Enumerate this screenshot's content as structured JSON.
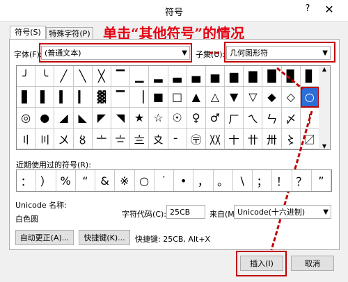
{
  "window": {
    "title": "符号",
    "help_label": "?",
    "close_label": "✕"
  },
  "tabs": [
    {
      "label": "符号(S)"
    },
    {
      "label": "特殊字符(P)"
    }
  ],
  "annotation": "单击“其他符号”的情况",
  "font": {
    "label": "字体(F):",
    "value": "(普通文本)"
  },
  "subset": {
    "label": "子集(U):",
    "value": "几何图形符"
  },
  "symbols": [
    [
      "╯",
      "╰",
      "╱",
      "╲",
      "╳",
      "▔",
      "▁",
      "▂",
      "▃",
      "▄",
      "▅",
      "▆",
      "▇",
      "█",
      "▉",
      "▊"
    ],
    [
      "▋",
      "▌",
      "▍",
      "▎",
      "▓",
      "▔",
      "▕",
      "■",
      "□",
      "▲",
      "△",
      "▼",
      "▽",
      "◆",
      "◇",
      "○"
    ],
    [
      "◎",
      "●",
      "◢",
      "◣",
      "◤",
      "◥",
      "★",
      "☆",
      "☉",
      "♀",
      "♂",
      "ㄏ",
      "ㄟ",
      "ㄣ",
      "〆",
      "〡"
    ],
    [
      "〢",
      "〣",
      "〤",
      "〥",
      "〦",
      "〧",
      "〨",
      "〩",
      "╴",
      "〶",
      "〷",
      "〸",
      "〹",
      "〺",
      "〻",
      "〼"
    ]
  ],
  "selected_symbol": {
    "row": 1,
    "col": 15
  },
  "recent": {
    "label": "近期使用过的符号(R):",
    "items": [
      "：",
      "）",
      "%",
      "“",
      "&",
      "※",
      "○",
      "˙",
      "•",
      "，",
      "。",
      "\\",
      "；",
      "！",
      "？",
      "”"
    ]
  },
  "info": {
    "unicode_name_label": "Unicode 名称:",
    "unicode_name_value": "白色圆",
    "char_code_label": "字符代码(C):",
    "char_code_value": "25CB",
    "from_label": "来自(M):",
    "from_value": "Unicode(十六进制)"
  },
  "buttons": {
    "autocorrect": "自动更正(A)...",
    "shortcut_key": "快捷键(K)...",
    "shortcut_text": "快捷键: 25CB, Alt+X",
    "insert": "插入(I)",
    "cancel": "取消"
  },
  "colors": {
    "annotation": "#e60012",
    "highlight": "#c00000",
    "selected_bg": "#2b6ed9"
  }
}
